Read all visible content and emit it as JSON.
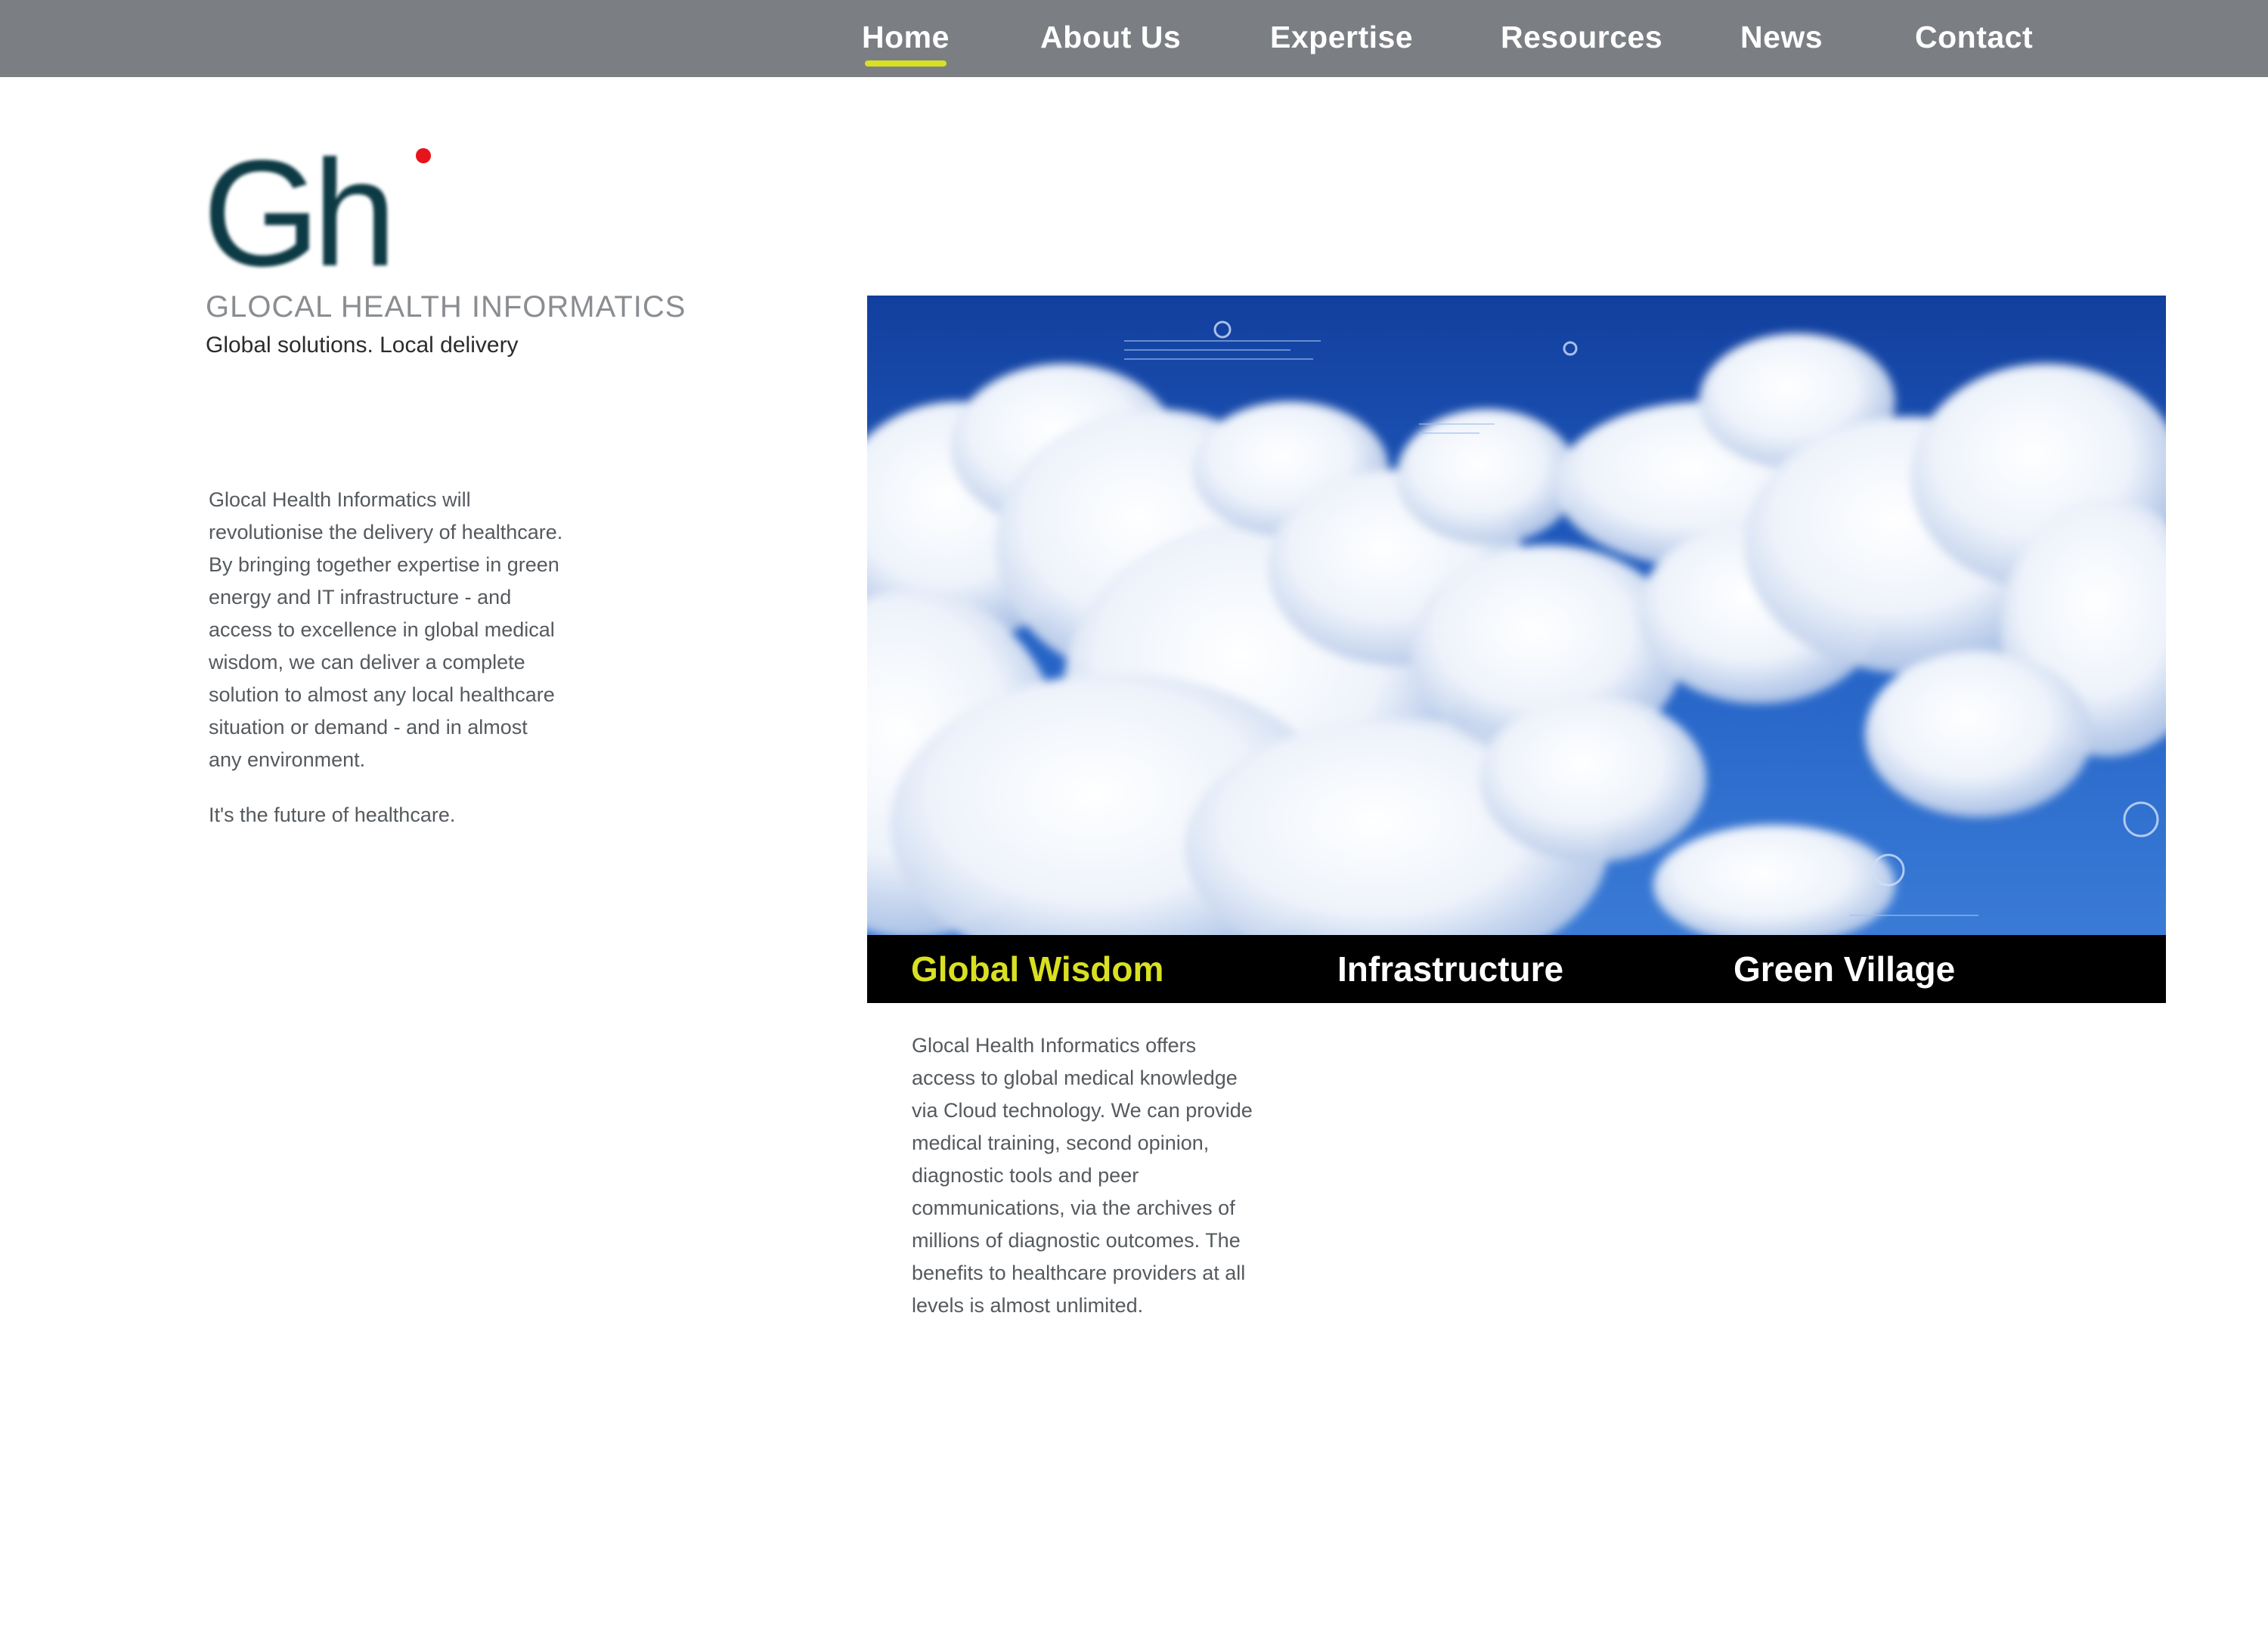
{
  "nav": {
    "items": [
      {
        "label": "Home",
        "active": true
      },
      {
        "label": "About Us"
      },
      {
        "label": "Expertise"
      },
      {
        "label": "Resources"
      },
      {
        "label": "News"
      },
      {
        "label": "Contact"
      }
    ]
  },
  "brand": {
    "logo_text": "Gh",
    "name": "GLOCAL HEALTH INFORMATICS",
    "tagline": "Global solutions. Local delivery",
    "colors": {
      "logo": "#0d3b44",
      "dot": "#e8141b"
    }
  },
  "intro": {
    "paragraph1": "Glocal Health Informatics will revolutionise the delivery of healthcare. By bringing together expertise in green energy and IT infrastructure - and access to excellence in global medical wisdom, we can deliver a complete solution to almost any local healthcare situation or demand - and in almost any environment.",
    "paragraph2": "It's the future of healthcare."
  },
  "slider": {
    "tabs": [
      {
        "label": "Global Wisdom",
        "active": true
      },
      {
        "label": "Infrastructure"
      },
      {
        "label": "Green Village"
      }
    ],
    "description": "Glocal Health Informatics offers access to global medical knowledge via Cloud technology. We can provide medical training, second opinion, diagnostic tools and peer communications, via the archives of millions of diagnostic outcomes. The benefits to healthcare providers at all levels is almost unlimited."
  },
  "colors": {
    "topbar": "#7b7f84",
    "accent": "#d9e021",
    "tabbar": "#000000",
    "sky": "#1f56b8"
  }
}
